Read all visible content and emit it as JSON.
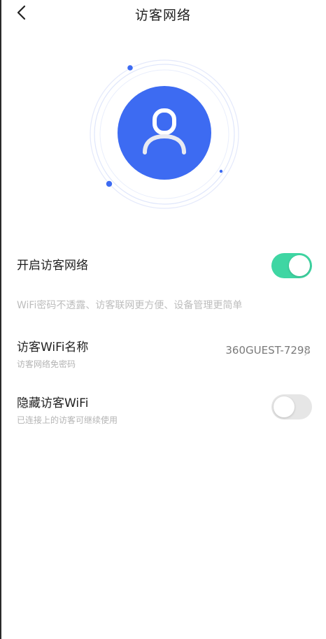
{
  "header": {
    "title": "访客网络",
    "back_icon": "chevron-left-icon"
  },
  "hero": {
    "icon": "user-icon",
    "accent_color": "#3d6bf2",
    "ring_color": "#dfe6fb"
  },
  "guest_network": {
    "label": "开启访客网络",
    "enabled": true,
    "toggle_on_color": "#3fd6a3"
  },
  "hint_text": "WiFi密码不透露、访客联网更方便、设备管理更简单",
  "ssid": {
    "label": "访客WiFi名称",
    "sublabel": "访客网络免密码",
    "value": "360GUEST-7298",
    "chevron_icon": "chevron-right-icon"
  },
  "hide_ssid": {
    "label": "隐藏访客WiFi",
    "sublabel": "已连接上的访客可继续使用",
    "enabled": false,
    "toggle_off_color": "#e6e6e6"
  }
}
